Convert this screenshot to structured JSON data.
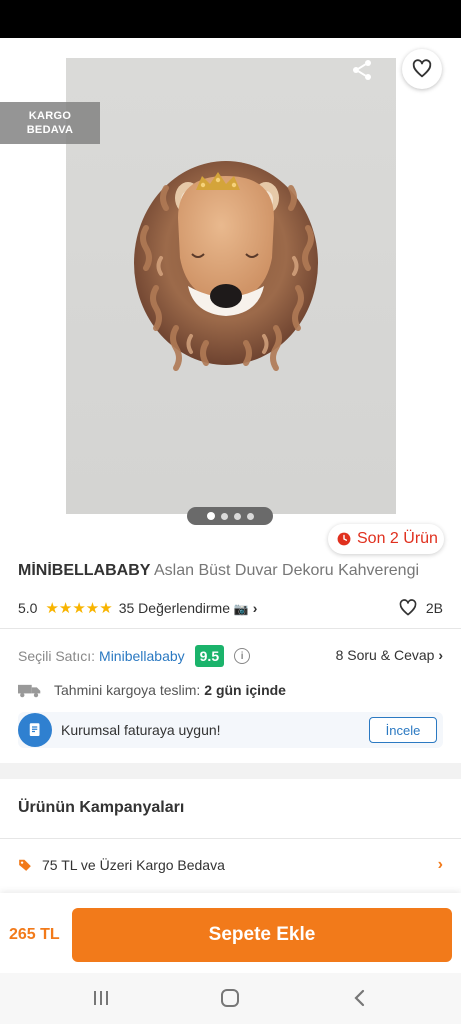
{
  "badge": {
    "cargo_line1": "KARGO",
    "cargo_line2": "BEDAVA"
  },
  "gallery": {
    "image_count": 4,
    "active_index": 1
  },
  "stock": {
    "label": "Son 2 Ürün"
  },
  "product": {
    "brand": "MİNİBELLABABY",
    "name": "Aslan Büst Duvar Dekoru Kahverengi",
    "rating": "5.0",
    "stars": "★★★★★",
    "reviews": "35 Değerlendirme",
    "favorites": "2B"
  },
  "seller": {
    "label": "Seçili Satıcı:",
    "name": "Minibellababy",
    "score": "9.5",
    "qa": "8 Soru & Cevap"
  },
  "delivery": {
    "label": "Tahmini kargoya teslim:",
    "value": "2 gün içinde"
  },
  "corporate": {
    "text": "Kurumsal faturaya uygun!",
    "button": "İncele"
  },
  "campaigns": {
    "title": "Ürünün Kampanyaları",
    "items": [
      {
        "label": "75 TL ve Üzeri Kargo Bedava"
      }
    ]
  },
  "purchase": {
    "price": "265 TL",
    "add_to_cart": "Sepete Ekle"
  },
  "colors": {
    "accent": "#f27a1a",
    "link": "#2b79c2",
    "score_bg": "#1bb36b",
    "stock_red": "#e0301e",
    "star": "#f8b400"
  }
}
